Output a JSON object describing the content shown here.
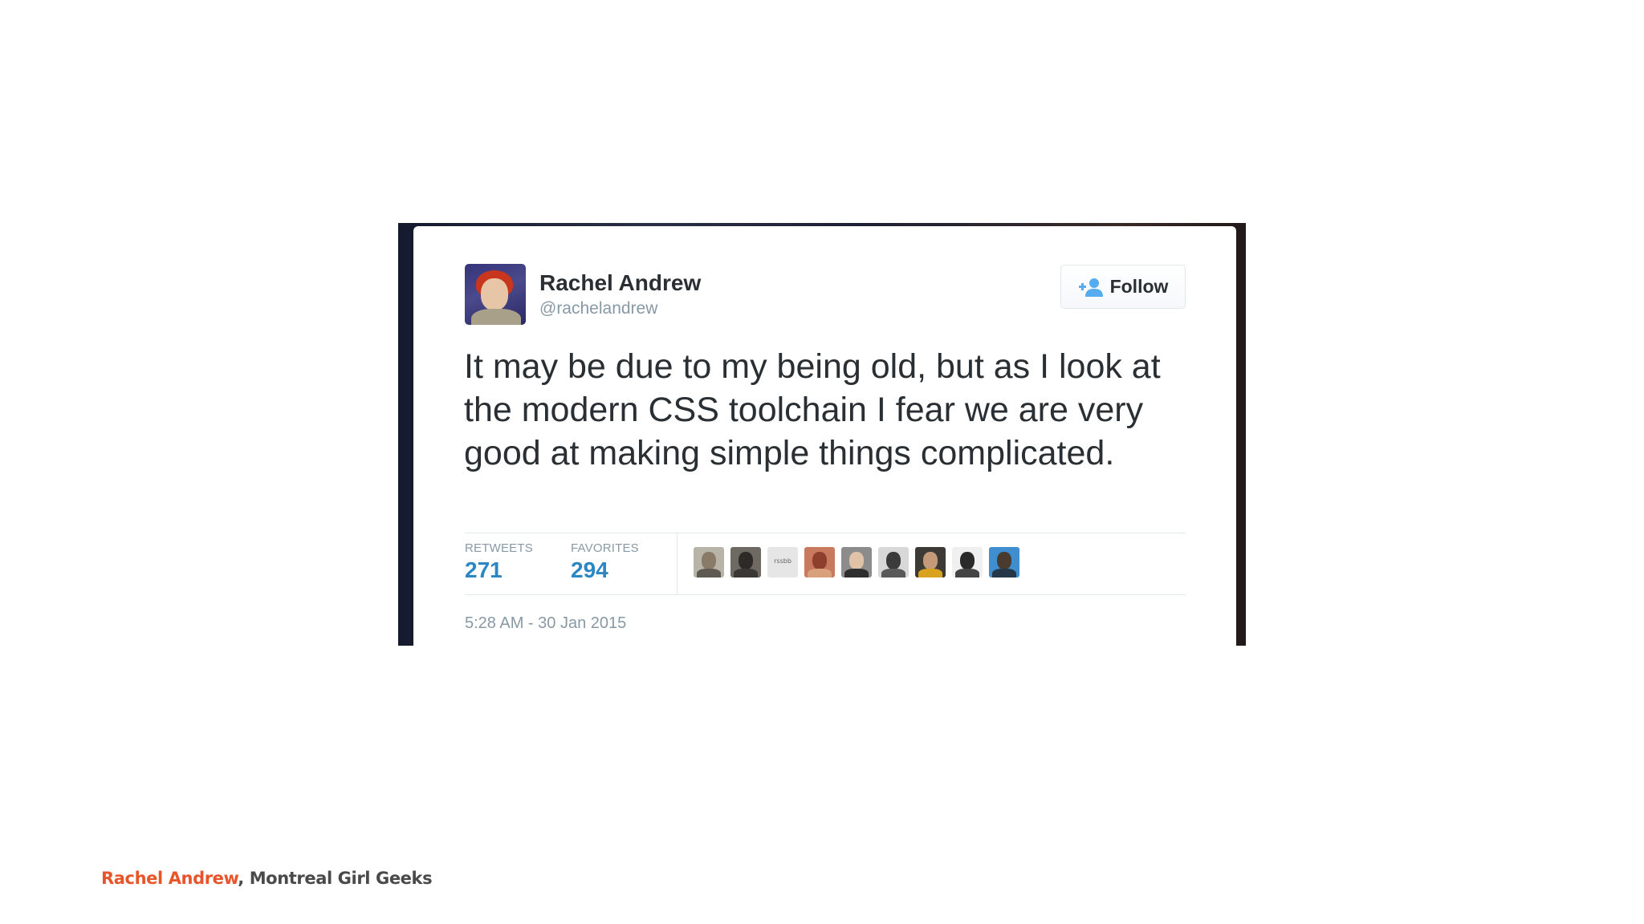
{
  "tweet": {
    "display_name": "Rachel Andrew",
    "screen_name": "@rachelandrew",
    "follow_label": "Follow",
    "follow_icon": "add-user-icon",
    "text": "It may be due to my being old, but as I look at the modern CSS toolchain I fear we are very good at making simple things complicated.",
    "stats": {
      "retweets_label": "RETWEETS",
      "retweets_value": "271",
      "favorites_label": "FAVORITES",
      "favorites_value": "294"
    },
    "favoriters_count": 9,
    "favoriter_logo_text": "rssbb",
    "timestamp": "5:28 AM - 30 Jan 2015"
  },
  "footer": {
    "author": "Rachel Andrew",
    "separator": ", ",
    "event": "Montreal Girl Geeks"
  },
  "colors": {
    "accent_blue": "#2a87c4",
    "follow_icon_blue": "#55acee",
    "footer_author": "#e8552b",
    "text_dark": "#292f33",
    "text_muted": "#8899a6"
  }
}
